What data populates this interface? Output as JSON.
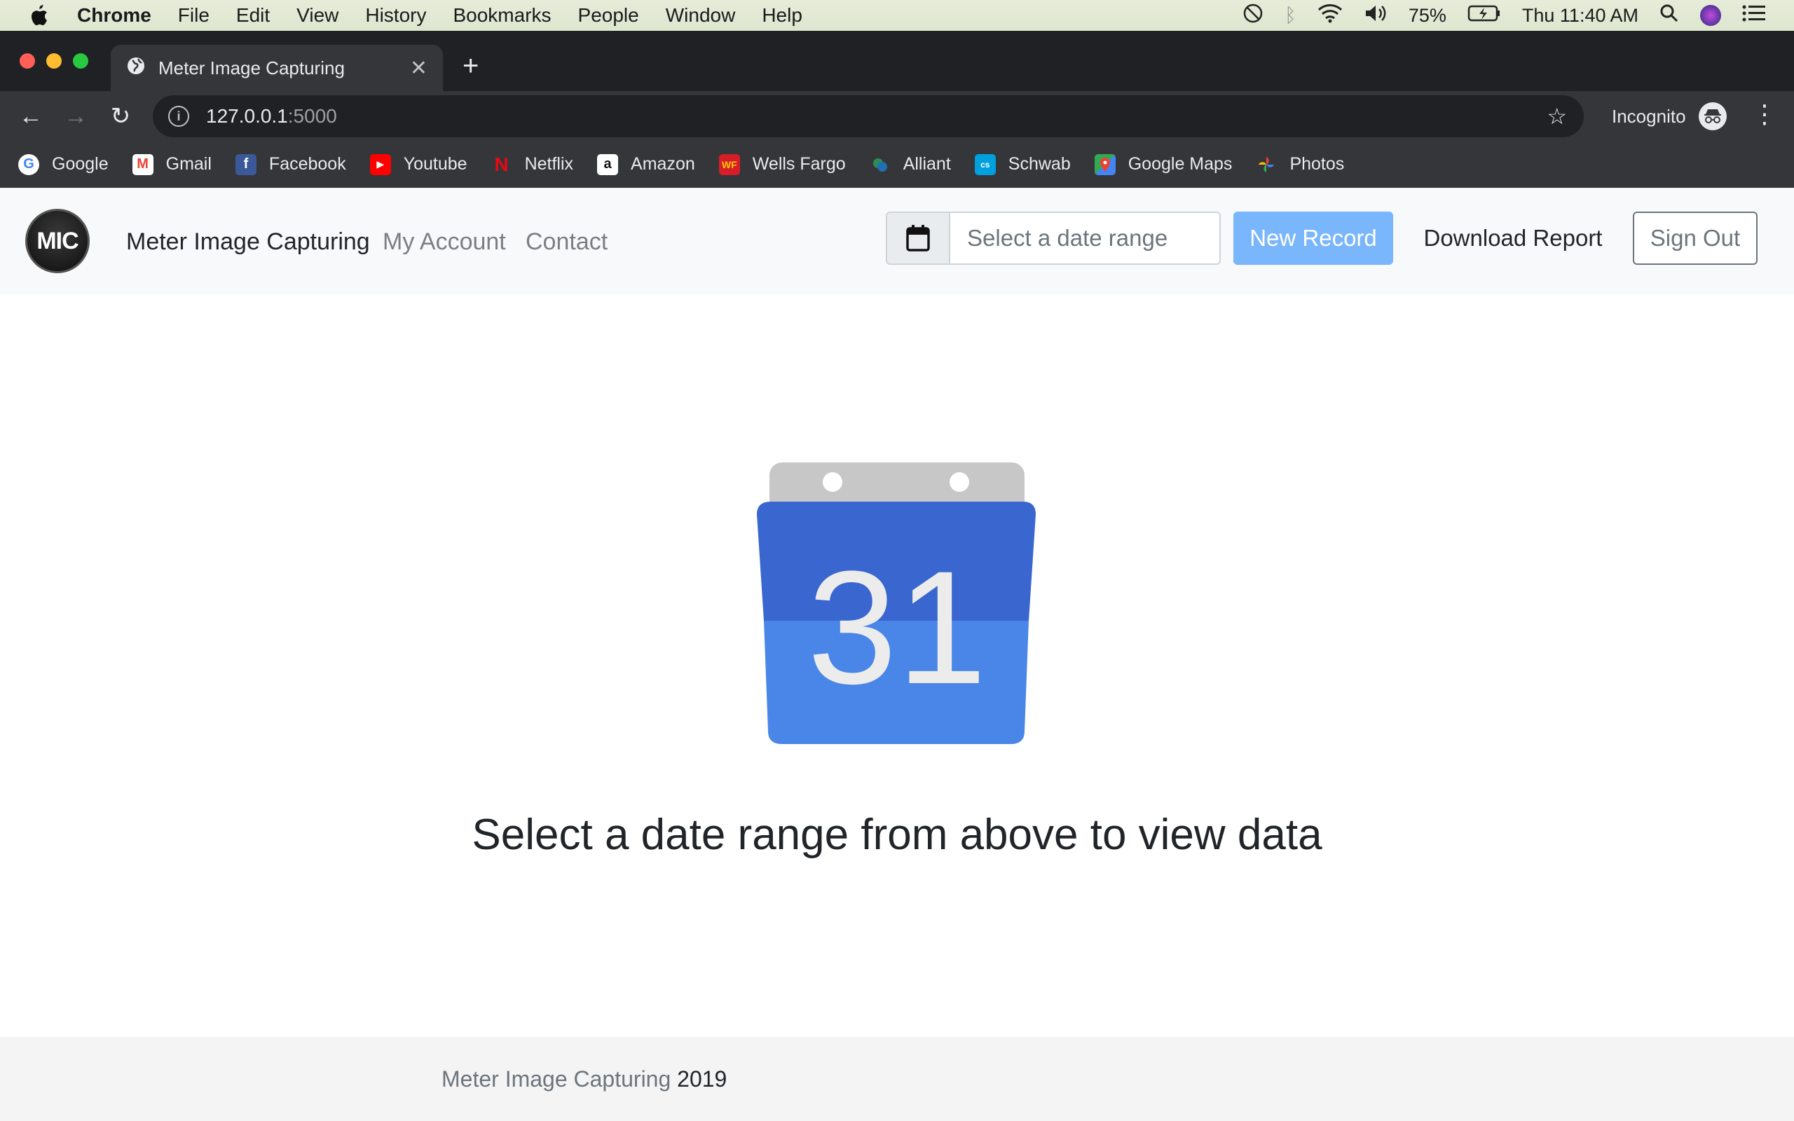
{
  "menubar": {
    "app": "Chrome",
    "items": [
      "File",
      "Edit",
      "View",
      "History",
      "Bookmarks",
      "People",
      "Window",
      "Help"
    ],
    "battery": "75%",
    "clock": "Thu 11:40 AM"
  },
  "browser": {
    "tab_title": "Meter Image Capturing",
    "url_host": "127.0.0.1",
    "url_port": ":5000",
    "profile_label": "Incognito",
    "bookmarks": [
      {
        "label": "Google",
        "icon": "google-icon",
        "color": "#4285f4"
      },
      {
        "label": "Gmail",
        "icon": "gmail-icon",
        "color": "#ea4335"
      },
      {
        "label": "Facebook",
        "icon": "facebook-icon",
        "color": "#3b5998"
      },
      {
        "label": "Youtube",
        "icon": "youtube-icon",
        "color": "#ff0000"
      },
      {
        "label": "Netflix",
        "icon": "netflix-icon",
        "color": "#e50914"
      },
      {
        "label": "Amazon",
        "icon": "amazon-icon",
        "color": "#ffffff"
      },
      {
        "label": "Wells Fargo",
        "icon": "wellsfargo-icon",
        "color": "#d71e28"
      },
      {
        "label": "Alliant",
        "icon": "alliant-icon",
        "color": "#2e8b57"
      },
      {
        "label": "Schwab",
        "icon": "schwab-icon",
        "color": "#00a0df"
      },
      {
        "label": "Google Maps",
        "icon": "maps-icon",
        "color": "#34a853"
      },
      {
        "label": "Photos",
        "icon": "photos-icon",
        "color": "#fbbc05"
      }
    ]
  },
  "site": {
    "logo_text": "MIC",
    "brand": "Meter Image Capturing",
    "nav": [
      "My Account",
      "Contact"
    ],
    "date_placeholder": "Select a date range",
    "new_record": "New Record",
    "download_report": "Download Report",
    "sign_out": "Sign Out",
    "calendar_day": "31",
    "empty_message": "Select a date range from above to view data",
    "footer_name": "Meter Image Capturing",
    "footer_year": "2019",
    "colors": {
      "primary_button": "#7ab6fb",
      "calendar_top": "#3a66cf",
      "calendar_bottom": "#4a86e8"
    }
  }
}
